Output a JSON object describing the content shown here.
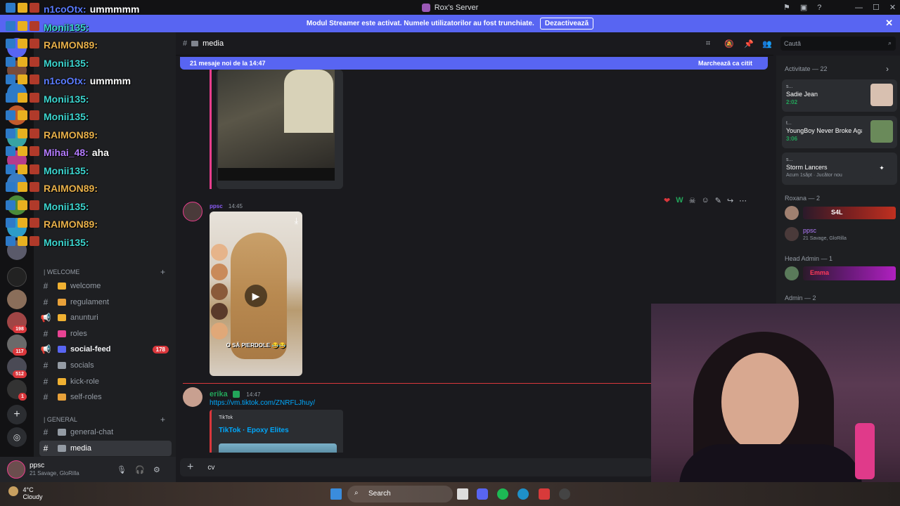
{
  "window": {
    "title": "Rox's Server"
  },
  "banner": {
    "text": "Modul Streamer este activat. Numele utilizatorilor au fost trunchiate.",
    "button": "Dezactivează"
  },
  "guild_badges": [
    "178",
    "198",
    "117",
    "512",
    "1"
  ],
  "channels": {
    "welcome_category": "| WELCOME",
    "welcome_items": [
      {
        "name": "welcome",
        "icon": "#",
        "emoji_color": "#f0b132"
      },
      {
        "name": "regulament",
        "icon": "#",
        "emoji_color": "#e8a13a"
      },
      {
        "name": "anunturi",
        "icon": "megaphone",
        "emoji_color": "#f0b132"
      },
      {
        "name": "roles",
        "icon": "#",
        "emoji_color": "#e84393"
      },
      {
        "name": "social-feed",
        "icon": "megaphone",
        "emoji_color": "#5865f2",
        "count": "178"
      },
      {
        "name": "socials",
        "icon": "#",
        "emoji_color": "#949ba4"
      },
      {
        "name": "kick-role",
        "icon": "#",
        "emoji_color": "#f0b132"
      },
      {
        "name": "self-roles",
        "icon": "#",
        "emoji_color": "#e8a13a"
      }
    ],
    "general_category": "| GENERAL",
    "general_items": [
      {
        "name": "general-chat",
        "icon": "#"
      },
      {
        "name": "media",
        "icon": "#",
        "selected": true
      }
    ]
  },
  "user_panel": {
    "name": "ppsc",
    "status": "21 Savage, GloRilla"
  },
  "chat_header": {
    "channel": "media"
  },
  "new_messages": {
    "left": "21 mesaje noi de la 14:47",
    "right": "Marchează ca citit"
  },
  "search": {
    "placeholder": "Caută"
  },
  "members": {
    "activity_header": "Activitate — 22",
    "activities": [
      {
        "user": "s...",
        "title": "Sadie Jean",
        "sub": "2:02"
      },
      {
        "user": "t...",
        "title": "YoungBoy Never Broke Aga...",
        "sub": "3:06"
      },
      {
        "user": "s...",
        "title": "Storm Lancers",
        "sub": "Acum 1săpt · Jucător nou"
      }
    ],
    "roxana_header": "Roxana — 2",
    "roxana_members": [
      {
        "name": "S4L"
      },
      {
        "name": "ppsc",
        "status": "21 Savage, GloRilla"
      }
    ],
    "headadmin_header": "Head Admin — 1",
    "headadmin_member": "Emma",
    "admin_header": "Admin — 2"
  },
  "messages": [
    {
      "author": "ppsc",
      "time": "14:45",
      "video_caption": "O SĂ PIERDOLE 😂😂"
    },
    {
      "author": "erika",
      "time": "14:47",
      "link": "https://vm.tiktok.com/ZNRFLJhuy/",
      "embed_site": "TikTok",
      "embed_title": "TikTok · Epoxy Elites"
    }
  ],
  "composer": {
    "value": "cv"
  },
  "weather": {
    "temp": "4°C",
    "cond": "Cloudy"
  },
  "taskbar": {
    "search": "Search"
  },
  "overlay_chat": [
    {
      "name": "n1coOtx:",
      "msg": "ummmmm",
      "color": "#5b7cff"
    },
    {
      "name": "Monii135:",
      "msg": "",
      "color": "#3cd6d0"
    },
    {
      "name": "RAIMON89:",
      "msg": "",
      "color": "#e8b04a"
    },
    {
      "name": "Monii135:",
      "msg": "",
      "color": "#3cd6d0"
    },
    {
      "name": "n1coOtx:",
      "msg": "ummmm",
      "color": "#5b7cff"
    },
    {
      "name": "Monii135:",
      "msg": "",
      "color": "#3cd6d0"
    },
    {
      "name": "Monii135:",
      "msg": "",
      "color": "#3cd6d0"
    },
    {
      "name": "RAIMON89:",
      "msg": "",
      "color": "#e8b04a"
    },
    {
      "name": "Mihai_48:",
      "msg": "aha",
      "color": "#b47cff"
    },
    {
      "name": "Monii135:",
      "msg": "",
      "color": "#3cd6d0"
    },
    {
      "name": "RAIMON89:",
      "msg": "",
      "color": "#e8b04a"
    },
    {
      "name": "Monii135:",
      "msg": "",
      "color": "#3cd6d0"
    },
    {
      "name": "RAIMON89:",
      "msg": "",
      "color": "#e8b04a"
    },
    {
      "name": "Monii135:",
      "msg": "",
      "color": "#3cd6d0"
    }
  ],
  "colors": {
    "accent": "#5865f2",
    "danger": "#da373c",
    "bg": "#1a1a1e"
  }
}
